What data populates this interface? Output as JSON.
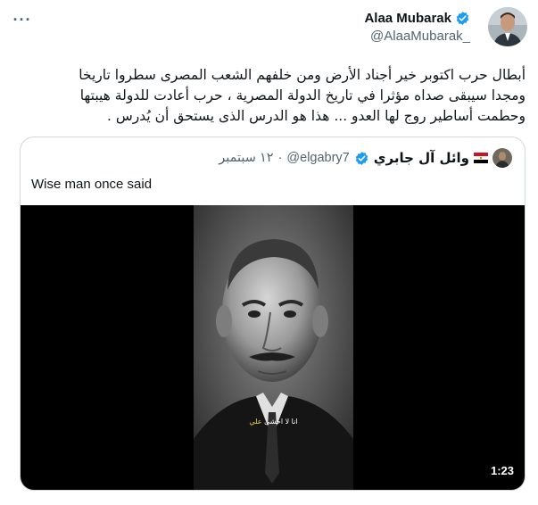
{
  "header": {
    "display_name": "Alaa Mubarak",
    "handle": "@AlaaMubarak_",
    "verified": true,
    "more_icon": "more-dots-icon"
  },
  "tweet": {
    "lines": [
      "أبطال حرب اكتوبر خير أجناد الأرض ومن خلفهم الشعب المصرى سطروا تاريخا",
      "ومجدا سيبقى صداه مؤثرا في تاريخ الدولة المصرية ، حرب أعادت للدولة هيبتها",
      "وحطمت أساطير روج لها العدو ... هذا هو الدرس الذى يستحق أن يُدرس ."
    ]
  },
  "quote": {
    "display_name": "وائل آل جابري",
    "flag_icon": "egypt-flag-icon",
    "verified": true,
    "handle": "@elgabry7",
    "dot": "·",
    "date": "١٢ سبتمبر",
    "text": "Wise man once said",
    "video": {
      "caption_prefix": "انا لا اخشى",
      "caption_highlight": "علي",
      "duration": "1:23"
    }
  },
  "colors": {
    "verified_blue": "#1d9bf0",
    "secondary_text": "#536471",
    "border": "#cfd9de"
  }
}
